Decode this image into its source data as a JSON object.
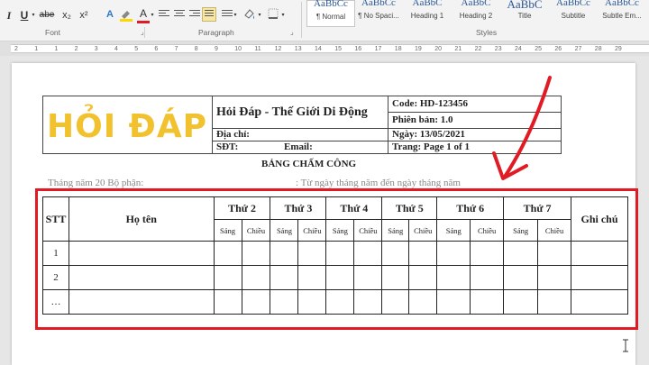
{
  "ribbon": {
    "font_buttons": [
      "I",
      "U",
      "abe",
      "x₂",
      "x²",
      "A"
    ],
    "groups": {
      "font": "Font",
      "paragraph": "Paragraph",
      "styles": "Styles"
    },
    "styles": [
      {
        "preview": "AaBbCc",
        "name": "¶ Normal"
      },
      {
        "preview": "AaBbCc",
        "name": "¶ No Spaci..."
      },
      {
        "preview": "AaBbC",
        "name": "Heading 1"
      },
      {
        "preview": "AaBbC",
        "name": "Heading 2"
      },
      {
        "preview": "AaBbC",
        "name": "Title"
      },
      {
        "preview": "AaBbCc",
        "name": "Subtitle"
      },
      {
        "preview": "AaBbCc",
        "name": "Subtle Em..."
      }
    ]
  },
  "ruler": {
    "ticks": [
      "2",
      "1",
      "1",
      "2",
      "3",
      "4",
      "5",
      "6",
      "7",
      "8",
      "9",
      "10",
      "11",
      "12",
      "13",
      "14",
      "15",
      "16",
      "17",
      "18",
      "19",
      "20",
      "21",
      "22",
      "23",
      "24",
      "25",
      "26",
      "27",
      "28",
      "29"
    ]
  },
  "header": {
    "company": "Hỏi Đáp - Thế Giới Di Động",
    "address_label": "Địa chỉ:",
    "phone_label": "SĐT:",
    "email_label": "Email:",
    "code": "Code: HD-123456",
    "version": "Phiên bản: 1.0",
    "date": "Ngày: 13/05/2021",
    "page": "Trang: Page 1 of 1",
    "logo_text": "HỎI ĐÁP"
  },
  "document": {
    "title": "BẢNG CHẤM CÔNG",
    "subline_left": "Tháng    năm 20     Bộ phận:",
    "subline_right": ": Từ ngày    tháng    năm    đến ngày    tháng    năm"
  },
  "table": {
    "col_stt": "STT",
    "col_name": "Họ tên",
    "col_note": "Ghi chú",
    "days": [
      "Thứ 2",
      "Thứ 3",
      "Thứ 4",
      "Thứ 5",
      "Thứ 6",
      "Thứ 7"
    ],
    "morning": "Sáng",
    "afternoon": "Chiều",
    "rows": [
      "1",
      "2",
      "…"
    ]
  },
  "colors": {
    "accent_red": "#e01b24",
    "logo_yellow": "#f2c12e"
  }
}
